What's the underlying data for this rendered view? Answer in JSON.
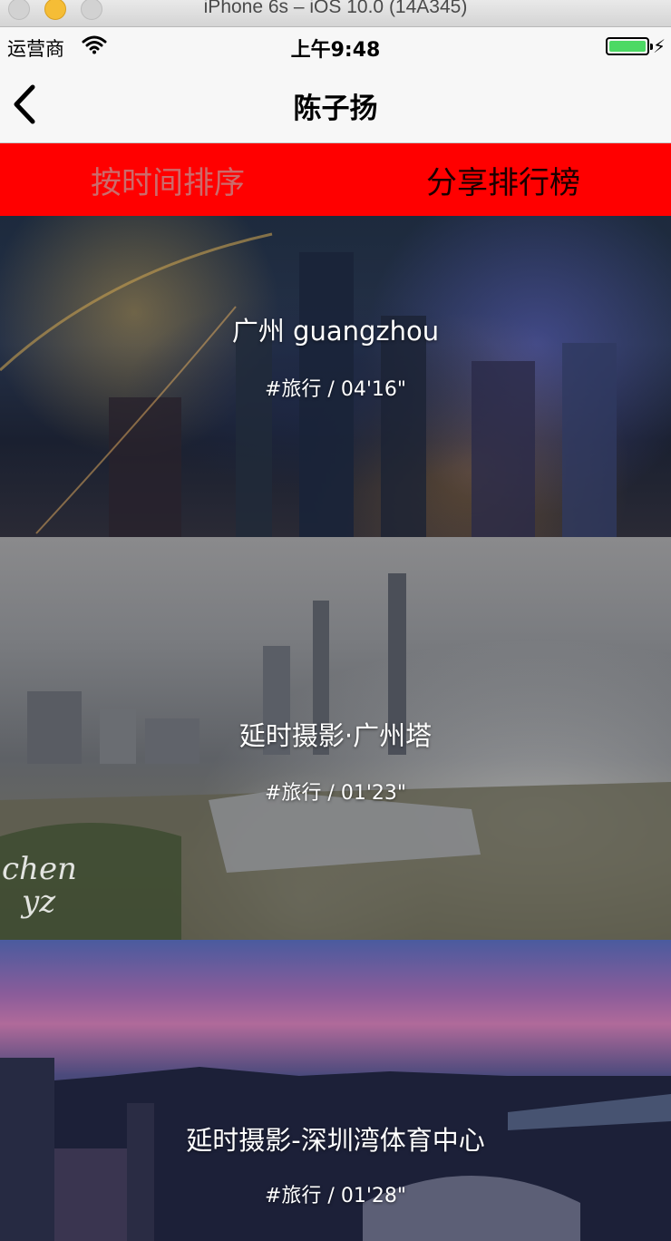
{
  "simulator": {
    "title": "iPhone 6s – iOS 10.0 (14A345)"
  },
  "status_bar": {
    "carrier": "运营商",
    "time": "上午9:48",
    "battery_level": 1.0
  },
  "nav": {
    "title": "陈子扬",
    "back_icon": "chevron-left-icon"
  },
  "tabs": [
    {
      "label": "按时间排序"
    },
    {
      "label": "分享排行榜"
    }
  ],
  "videos": [
    {
      "title": "广州 guangzhou",
      "meta": "#旅行 / 04'16\""
    },
    {
      "title": "延时摄影·广州塔",
      "meta": "#旅行 / 01'23\"",
      "watermark_line1": "chen",
      "watermark_line2": "yz"
    },
    {
      "title": "延时摄影-深圳湾体育中心",
      "meta": "#旅行 / 01'28\""
    }
  ],
  "colors": {
    "tab_bar": "#ff0000",
    "tab_inactive_text": "#cc6b6b",
    "tab_active_text": "#1a0000",
    "battery": "#4cd964"
  }
}
